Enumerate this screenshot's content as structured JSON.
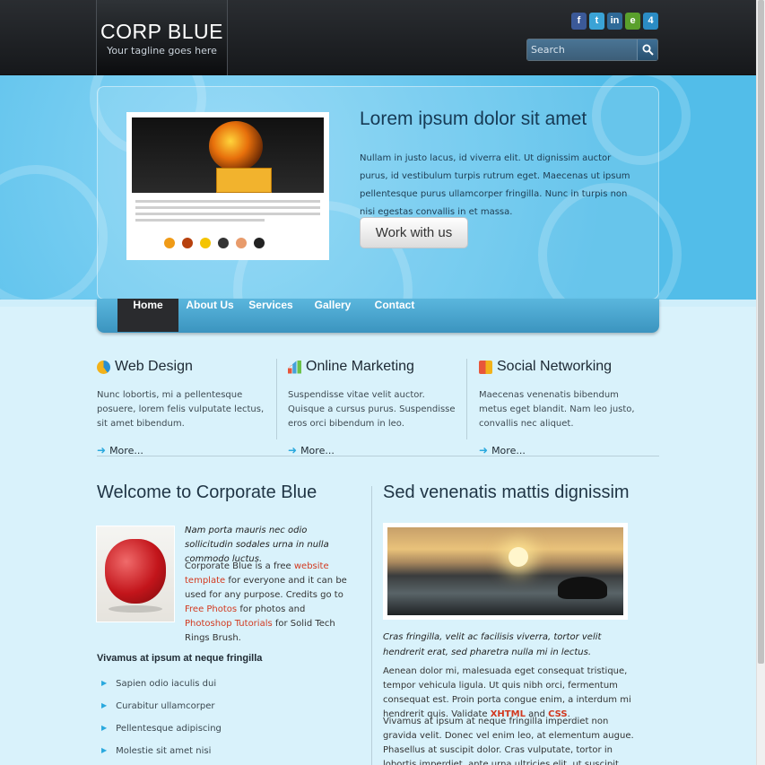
{
  "header": {
    "logo_title": "CORP BLUE",
    "logo_tagline": "Your tagline goes here",
    "social": [
      {
        "icon": "facebook-icon",
        "glyph": "f",
        "color": "#3b5998"
      },
      {
        "icon": "twitter-icon",
        "glyph": "t",
        "color": "#3aa3d6"
      },
      {
        "icon": "linkedin-icon",
        "glyph": "in",
        "color": "#2f6a98"
      },
      {
        "icon": "evernote-icon",
        "glyph": "e",
        "color": "#5aa02c"
      },
      {
        "icon": "foursquare-icon",
        "glyph": "4",
        "color": "#2b8cc4"
      }
    ],
    "search_placeholder": "Search"
  },
  "hero": {
    "title": "Lorem ipsum dolor sit amet",
    "text": "Nullam in justo lacus, id viverra elit. Ut dignissim auctor purus, id vestibulum turpis rutrum eget. Maecenas ut ipsum pellentesque purus ullamcorper fringilla. Nunc in turpis non nisi egestas convallis in et massa.",
    "button": "Work with us"
  },
  "nav": [
    "Home",
    "About Us",
    "Services",
    "Gallery",
    "Contact"
  ],
  "features": [
    {
      "title": "Web Design",
      "text": "Nunc lobortis, mi a pellentesque posuere, lorem felis vulputate lectus, sit amet bibendum.",
      "more": "More..."
    },
    {
      "title": "Online Marketing",
      "text": "Suspendisse vitae velit auctor. Quisque a cursus purus. Suspendisse eros orci bibendum in leo.",
      "more": "More..."
    },
    {
      "title": "Social Networking",
      "text": "Maecenas venenatis bibendum metus eget blandit. Nam leo justo, convallis nec aliquet.",
      "more": "More..."
    }
  ],
  "left": {
    "title": "Welcome to Corporate Blue",
    "italic": "Nam porta mauris nec odio sollicitudin sodales urna in nulla commodo luctus.",
    "t1": "Corporate Blue is a free ",
    "l1": "website template",
    "t2": " for everyone and it can be used for any purpose. Credits go to ",
    "l2": "Free Photos",
    "t3": " for photos and ",
    "l3": "Photoshop Tutorials",
    "t4": " for Solid Tech Rings Brush.",
    "subhead": "Vivamus at ipsum at neque fringilla",
    "bullets": [
      "Sapien odio iaculis dui",
      "Curabitur ullamcorper",
      "Pellentesque adipiscing",
      "Molestie sit amet nisi"
    ]
  },
  "right": {
    "title": "Sed venenatis mattis dignissim",
    "italic": "Cras fringilla, velit ac facilisis viverra, tortor velit hendrerit erat, sed pharetra nulla mi in lectus.",
    "p1": "Aenean dolor mi, malesuada eget consequat tristique, tempor vehicula ligula. Ut quis nibh orci, fermentum consequat est. Proin porta congue enim, a interdum mi hendrerit quis. Validate ",
    "xhtml": "XHTML",
    "and": " and ",
    "css": "CSS",
    "dot": ".",
    "p2": "Vivamus at ipsum at neque fringilla imperdiet non gravida velit. Donec vel enim leo, at elementum augue. Phasellus at suscipit dolor. Cras vulputate, tortor in lobortis imperdiet, ante urna ultricies elit, ut suscipit luctus tortor a nulla"
  }
}
